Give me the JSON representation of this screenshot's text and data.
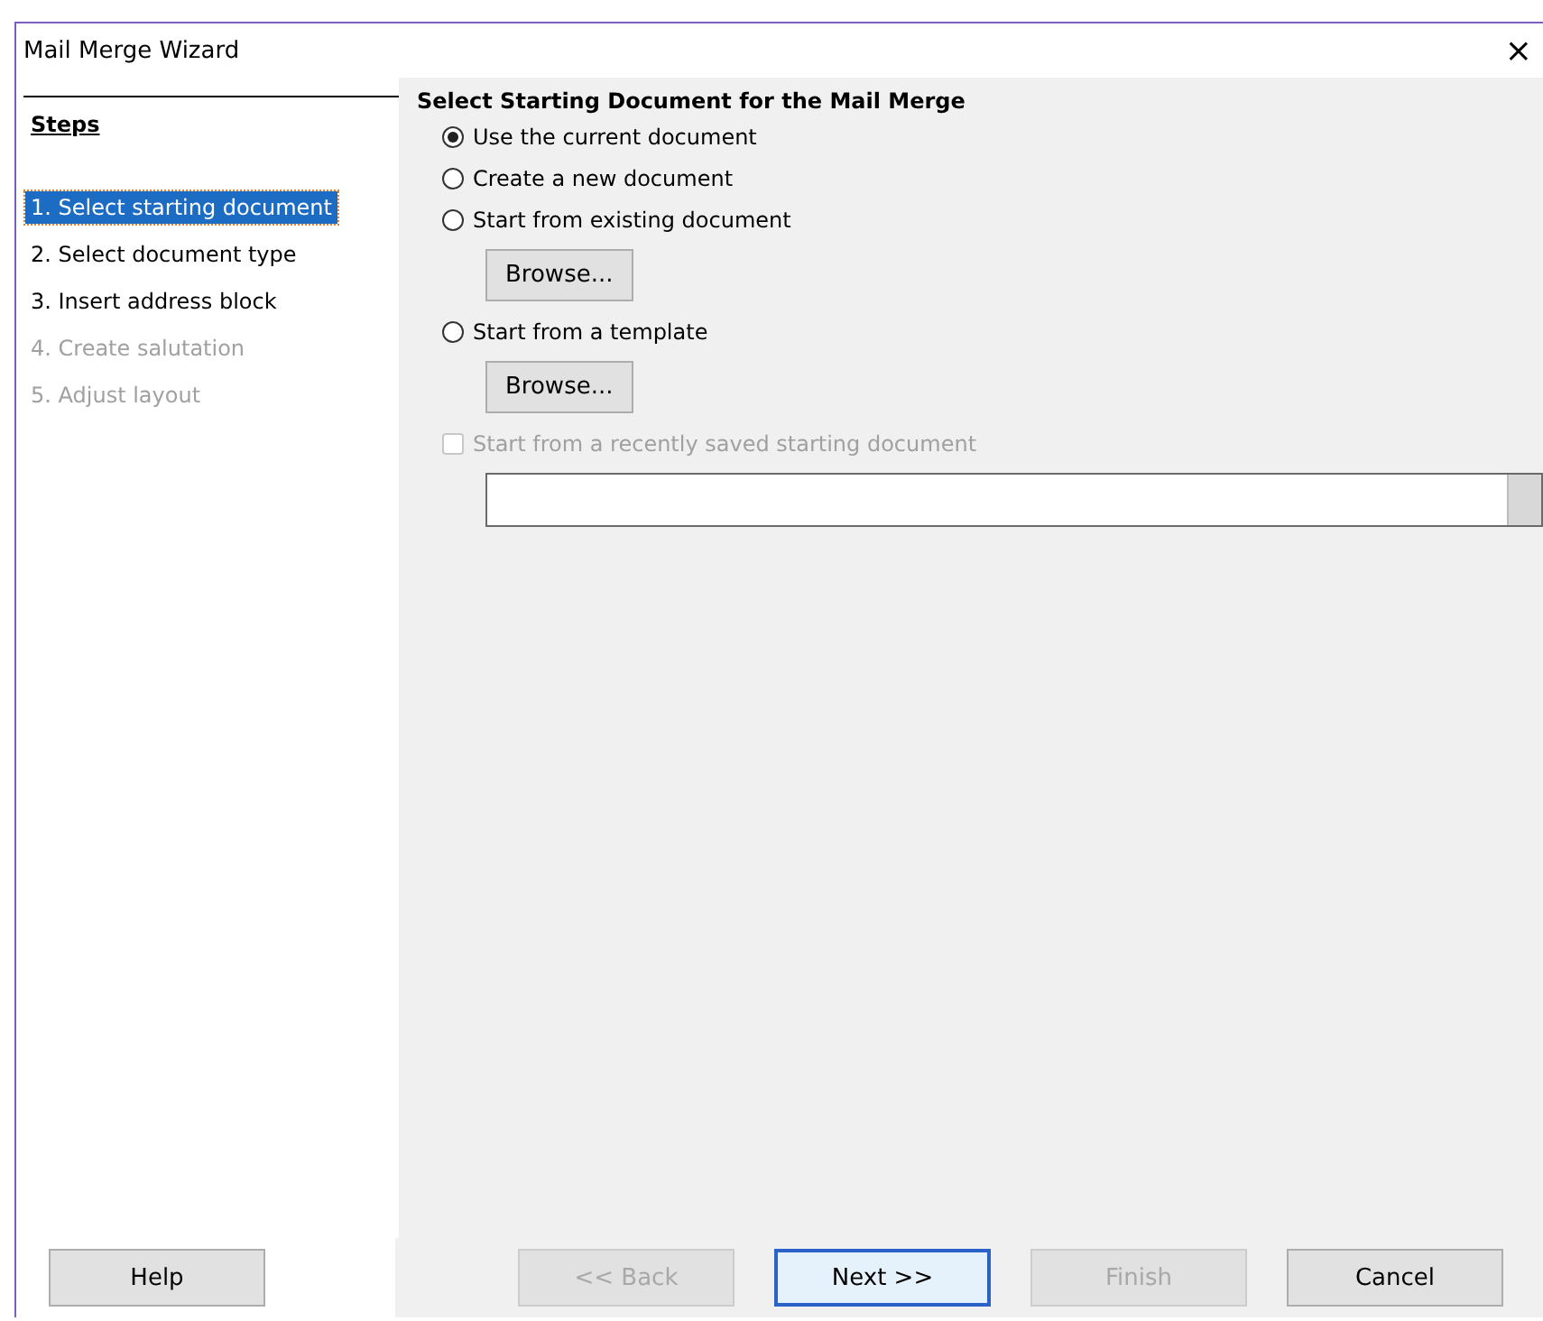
{
  "window": {
    "title": "Mail Merge Wizard",
    "close": "×"
  },
  "steps": {
    "heading": "Steps",
    "items": [
      {
        "label": "1. Select starting document",
        "selected": true,
        "disabled": false
      },
      {
        "label": "2. Select document type",
        "selected": false,
        "disabled": false
      },
      {
        "label": "3. Insert address block",
        "selected": false,
        "disabled": false
      },
      {
        "label": "4. Create salutation",
        "selected": false,
        "disabled": true
      },
      {
        "label": "5. Adjust layout",
        "selected": false,
        "disabled": true
      }
    ]
  },
  "page": {
    "title": "Select Starting Document for the Mail Merge",
    "options": [
      {
        "label": "Use the current document",
        "selected": true,
        "disabled": false
      },
      {
        "label": "Create a new document",
        "selected": false,
        "disabled": false
      },
      {
        "label": "Start from existing document",
        "selected": false,
        "disabled": false,
        "button": "Browse..."
      },
      {
        "label": "Start from a template",
        "selected": false,
        "disabled": false,
        "button": "Browse..."
      },
      {
        "label": "Start from a recently saved starting document",
        "selected": false,
        "disabled": true,
        "dropdown": true
      }
    ]
  },
  "buttons": [
    {
      "label": "Help",
      "disabled": false,
      "default": false
    },
    {
      "label": "<< Back",
      "disabled": true,
      "default": false
    },
    {
      "label": "Next >>",
      "disabled": false,
      "default": true
    },
    {
      "label": "Finish",
      "disabled": true,
      "default": false
    },
    {
      "label": "Cancel",
      "disabled": false,
      "default": false
    }
  ]
}
